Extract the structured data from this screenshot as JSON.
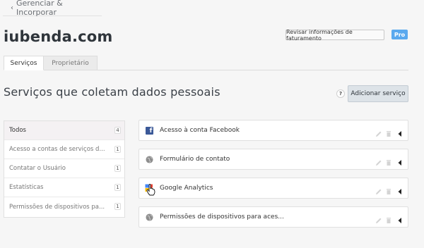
{
  "nav": {
    "back_arrow": "‹",
    "back_label": "Gerenciar & Incorporar"
  },
  "header": {
    "site_title": "iubenda.com",
    "billing_button": "Revisar informações de faturamento",
    "plan_badge": "Pro"
  },
  "tabs": [
    {
      "label": "Serviços",
      "active": true
    },
    {
      "label": "Proprietário",
      "active": false
    }
  ],
  "section": {
    "title": "Serviços que coletam dados pessoais",
    "help_label": "?",
    "add_button": "Adicionar serviço"
  },
  "sidebar": {
    "items": [
      {
        "label": "Todos",
        "count": "4",
        "active": true
      },
      {
        "label": "Acesso a contas de serviços d...",
        "count": "1"
      },
      {
        "label": "Contatar o Usuário",
        "count": "1"
      },
      {
        "label": "Estatísticas",
        "count": "1"
      },
      {
        "label": "Permissões de dispositivos pa...",
        "count": "1"
      }
    ]
  },
  "services": [
    {
      "label": "Acesso à conta Facebook",
      "icon": "facebook-icon"
    },
    {
      "label": "Formulário de contato",
      "icon": "globe-icon"
    },
    {
      "label": "Google Analytics",
      "icon": "google-analytics-icon"
    },
    {
      "label": "Permissões de dispositivos para aces...",
      "icon": "globe-icon"
    }
  ],
  "colors": {
    "accent": "#5aa9ee",
    "add_button_bg": "#dde3e8",
    "facebook": "#3b5998"
  }
}
